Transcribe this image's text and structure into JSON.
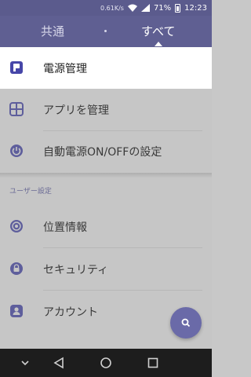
{
  "status_bar": {
    "network_speed": "0.61K/s",
    "battery_percent": "71%",
    "time": "12:23"
  },
  "tabs": [
    {
      "label": "共通",
      "selected": false
    },
    {
      "label": "すべて",
      "selected": true
    }
  ],
  "menu": {
    "top_items": [
      {
        "label": "電源管理",
        "icon": "power-manager-icon",
        "active": true
      },
      {
        "label": "アプリを管理",
        "icon": "app-grid-icon",
        "active": false
      },
      {
        "label": "自動電源ON/OFFの設定",
        "icon": "power-schedule-icon",
        "active": false
      }
    ],
    "section_header": "ユーザー設定",
    "user_items": [
      {
        "label": "位置情報",
        "icon": "location-icon"
      },
      {
        "label": "セキュリティ",
        "icon": "lock-icon"
      },
      {
        "label": "アカウント",
        "icon": "account-icon"
      }
    ]
  },
  "fab": {
    "icon": "search-icon"
  },
  "nav_bar": {
    "icons": [
      "chevron-down-icon",
      "back-icon",
      "home-icon",
      "recents-icon"
    ]
  },
  "colors": {
    "accent": "#5f5f92",
    "status_bar": "#5b5b8d",
    "icon": "#6a6aa8",
    "list_bg": "#c6c6c6",
    "nav_bar": "#1d1d1d"
  }
}
